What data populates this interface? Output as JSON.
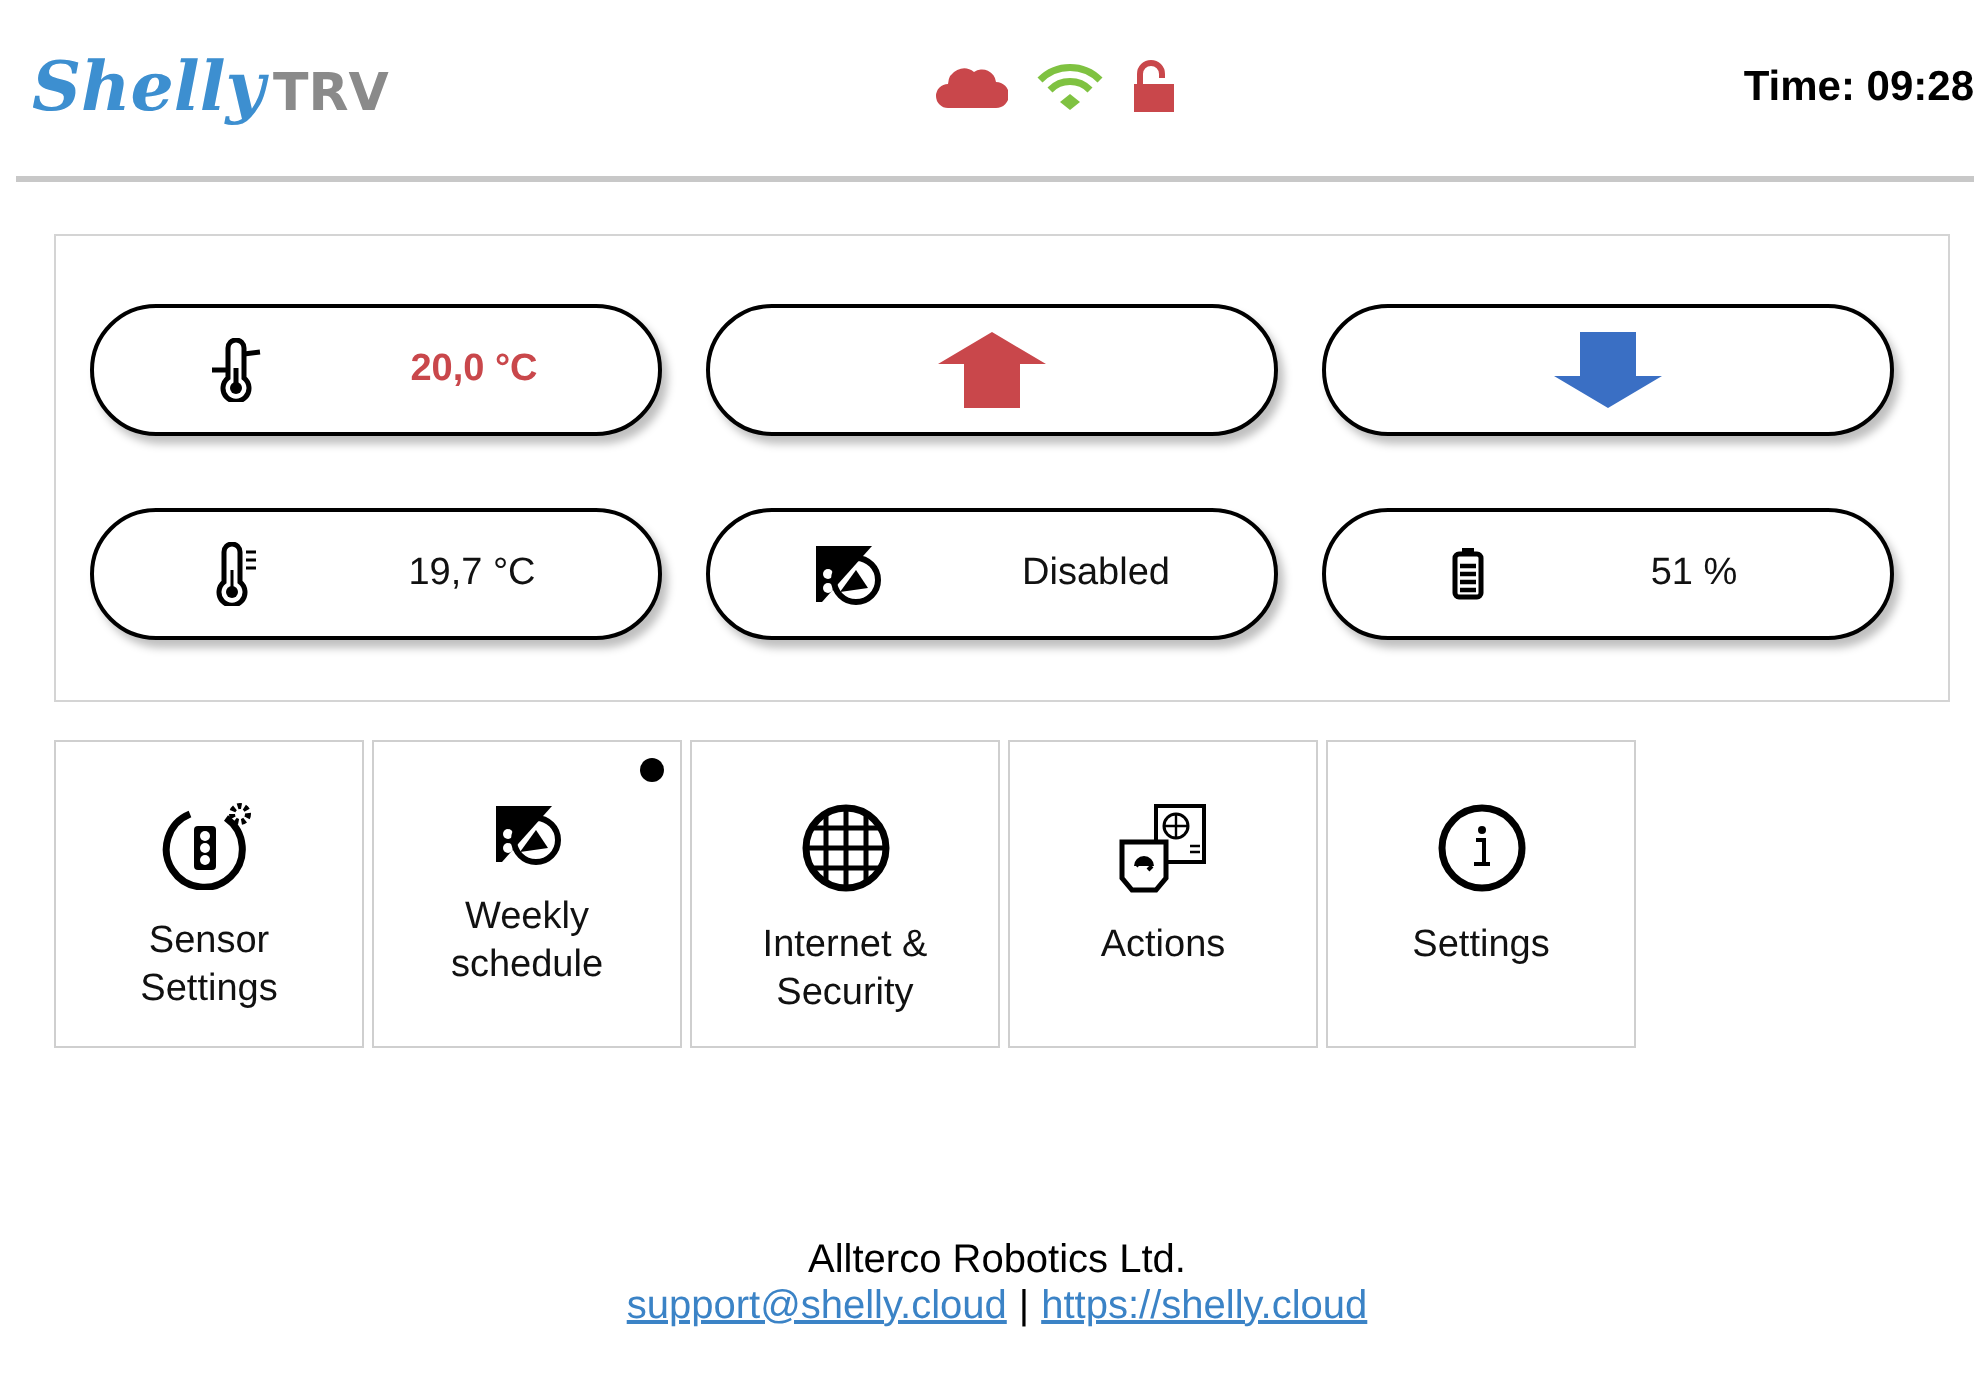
{
  "header": {
    "logo": "Shelly",
    "model": "TRV",
    "time": "Time: 09:28"
  },
  "status_icons": [
    {
      "kind": "cloud"
    },
    {
      "kind": "wifi"
    },
    {
      "kind": "lock"
    }
  ],
  "controls": [
    {
      "kind": "target",
      "value": "20,0 °C"
    },
    {
      "kind": "up"
    },
    {
      "kind": "down"
    },
    {
      "kind": "temperature",
      "value": "19,7 °C"
    },
    {
      "kind": "schedule",
      "value": "Disabled"
    },
    {
      "kind": "battery",
      "value": "51 %"
    }
  ],
  "tiles": [
    {
      "kind": "sensor",
      "label": "Sensor Settings",
      "badge": false
    },
    {
      "kind": "schedule",
      "label": "Weekly schedule",
      "badge": true
    },
    {
      "kind": "globe",
      "label": "Internet & Security",
      "badge": false
    },
    {
      "kind": "actions",
      "label": "Actions",
      "badge": false
    },
    {
      "kind": "info",
      "label": "Settings",
      "badge": false
    }
  ],
  "footer": {
    "company": "Allterco Robotics Ltd.",
    "email": "support@shelly.cloud",
    "separator": "|",
    "website": "https://shelly.cloud"
  }
}
